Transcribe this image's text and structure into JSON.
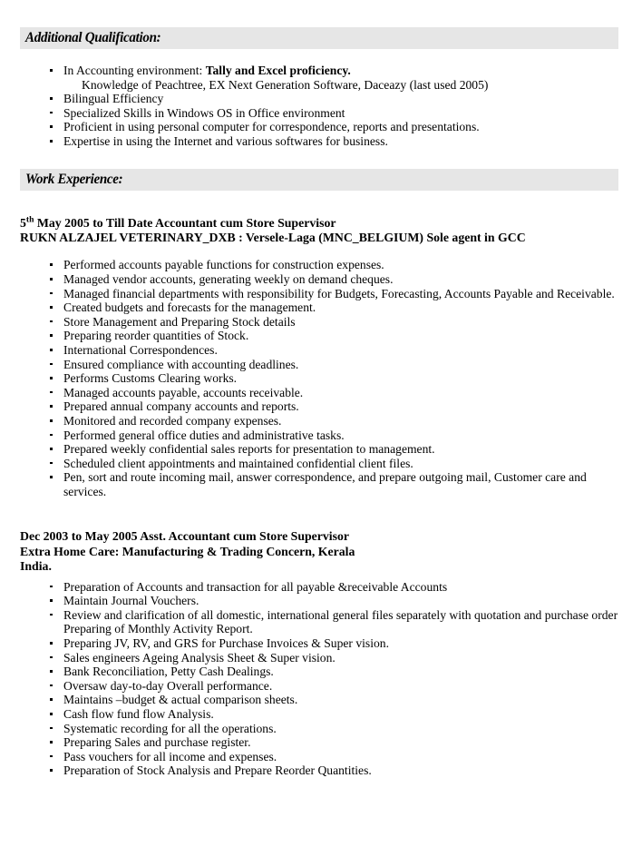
{
  "document": {
    "type": "resume",
    "band_color": "#e6e6e6",
    "text_color": "#000000",
    "background_color": "#ffffff"
  },
  "sections": {
    "additional_qualification": {
      "heading": "Additional Qualification:",
      "bullets": [
        {
          "lead": "In Accounting environment: ",
          "bold": "Tally and Excel proficiency.",
          "subline": "Knowledge of Peachtree, EX Next Generation Software, Daceazy (last used 2005)"
        },
        {
          "text": "Bilingual Efficiency"
        },
        {
          "text": "Specialized Skills in Windows OS in Office environment"
        },
        {
          "text": "Proficient in using personal computer for correspondence, reports and presentations."
        },
        {
          "text": "Expertise in using the Internet and various softwares for business."
        }
      ]
    },
    "work_experience": {
      "heading": "Work Experience:",
      "jobs": [
        {
          "date_prefix": "5",
          "date_superscript": "th",
          "title_line": " May 2005 to Till Date Accountant cum Store Supervisor",
          "employer_line": "RUKN ALZAJEL  VETERINARY_DXB : Versele-Laga (MNC_BELGIUM) Sole agent in GCC",
          "bullets": [
            "Performed accounts payable functions for construction expenses.",
            "Managed vendor accounts, generating weekly on demand cheques.",
            "Managed financial departments with responsibility for Budgets, Forecasting, Accounts Payable and Receivable.",
            "Created budgets and forecasts for the management.",
            "Store Management and Preparing Stock details",
            "Preparing reorder quantities of Stock.",
            "International Correspondences.",
            "Ensured compliance with accounting deadlines.",
            "Performs Customs Clearing works.",
            "Managed accounts payable, accounts receivable.",
            "Prepared annual company accounts and reports.",
            "Monitored and recorded company expenses.",
            "Performed general office duties and administrative tasks.",
            "Prepared weekly confidential sales reports for presentation to management.",
            "Scheduled client appointments and maintained confidential client files.",
            "Pen, sort and route incoming mail, answer correspondence, and prepare outgoing mail, Customer care and services."
          ]
        },
        {
          "title_line": "Dec 2003 to May 2005 Asst. Accountant cum Store Supervisor",
          "employer_line": "Extra Home Care: Manufacturing & Trading Concern, Kerala",
          "country_line": "India.",
          "bullets": [
            "Preparation of Accounts and transaction for all payable &receivable Accounts",
            "Maintain Journal Vouchers.",
            "Review and clarification of all domestic, international general files separately with quotation and purchase order Preparing of Monthly Activity Report.",
            "Preparing JV, RV, and GRS for Purchase Invoices & Super vision.",
            "Sales engineers Ageing Analysis Sheet & Super vision.",
            "Bank Reconciliation, Petty Cash Dealings.",
            "Oversaw day-to-day Overall performance.",
            "Maintains –budget & actual comparison sheets.",
            "Cash flow fund flow Analysis.",
            "Systematic recording for all the operations.",
            "Preparing Sales and purchase register.",
            "Pass vouchers for all income and expenses.",
            "Preparation of Stock Analysis and Prepare Reorder Quantities."
          ]
        }
      ]
    }
  }
}
